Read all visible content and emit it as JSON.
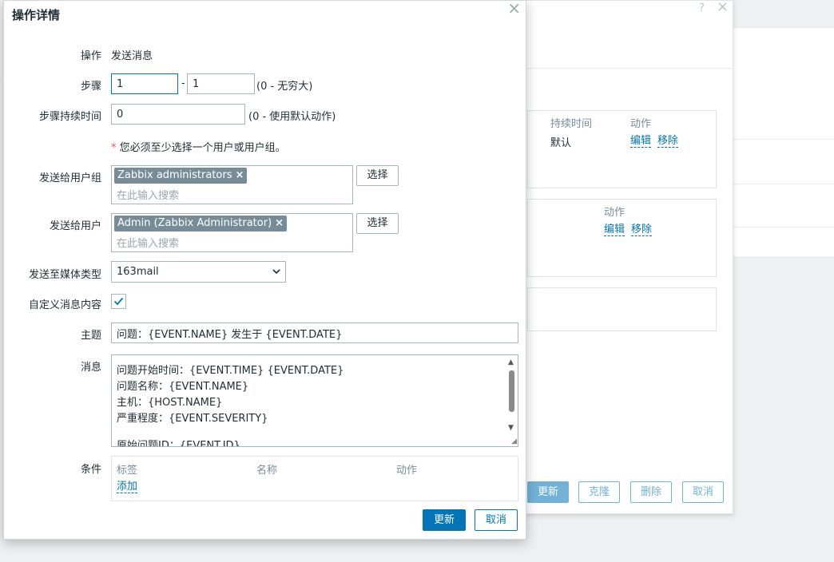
{
  "background": {
    "help_icon": "?",
    "close_icon": "×",
    "box1": {
      "col_duration": "持续时间",
      "col_action": "动作",
      "duration_value": "默认",
      "edit": "编辑",
      "remove": "移除"
    },
    "box2": {
      "col_action": "动作",
      "edit": "编辑",
      "remove": "移除"
    },
    "buttons": {
      "update": "更新",
      "clone": "克隆",
      "delete": "删除",
      "cancel": "取消"
    }
  },
  "dialog": {
    "title": "操作详情",
    "close_icon": "×",
    "operation": {
      "label": "操作",
      "value": "发送消息"
    },
    "steps": {
      "label": "步骤",
      "from": "1",
      "separator": "-",
      "to": "1",
      "hint": "(0 - 无穷大)"
    },
    "step_duration": {
      "label": "步骤持续时间",
      "value": "0",
      "hint": "(0 - 使用默认动作)"
    },
    "requirement": {
      "star": "*",
      "text": " 您必须至少选择一个用户或用户组。"
    },
    "user_groups": {
      "label": "发送给用户组",
      "chip": "Zabbix administrators",
      "chip_remove": "×",
      "placeholder": "在此输入搜索",
      "select_button": "选择"
    },
    "users": {
      "label": "发送给用户",
      "chip": "Admin (Zabbix Administrator)",
      "chip_remove": "×",
      "placeholder": "在此输入搜索",
      "select_button": "选择"
    },
    "media_type": {
      "label": "发送至媒体类型",
      "value": "163mail"
    },
    "custom_message": {
      "label": "自定义消息内容",
      "checked": true
    },
    "subject": {
      "label": "主题",
      "value": "问题：{EVENT.NAME} 发生于 {EVENT.DATE}"
    },
    "message": {
      "label": "消息",
      "lines": [
        "问题开始时间：{EVENT.TIME} {EVENT.DATE}",
        "问题名称：{EVENT.NAME}",
        "主机：{HOST.NAME}",
        "严重程度：{EVENT.SEVERITY}",
        "",
        "原始问题ID：{EVENT.ID}"
      ]
    },
    "conditions": {
      "label": "条件",
      "col_label": "标签",
      "col_name": "名称",
      "col_action": "动作",
      "add_link": "添加"
    },
    "buttons": {
      "update": "更新",
      "cancel": "取消"
    }
  },
  "colors": {
    "accent": "#0275b8",
    "chip": "#768d99",
    "required": "#e45959"
  }
}
